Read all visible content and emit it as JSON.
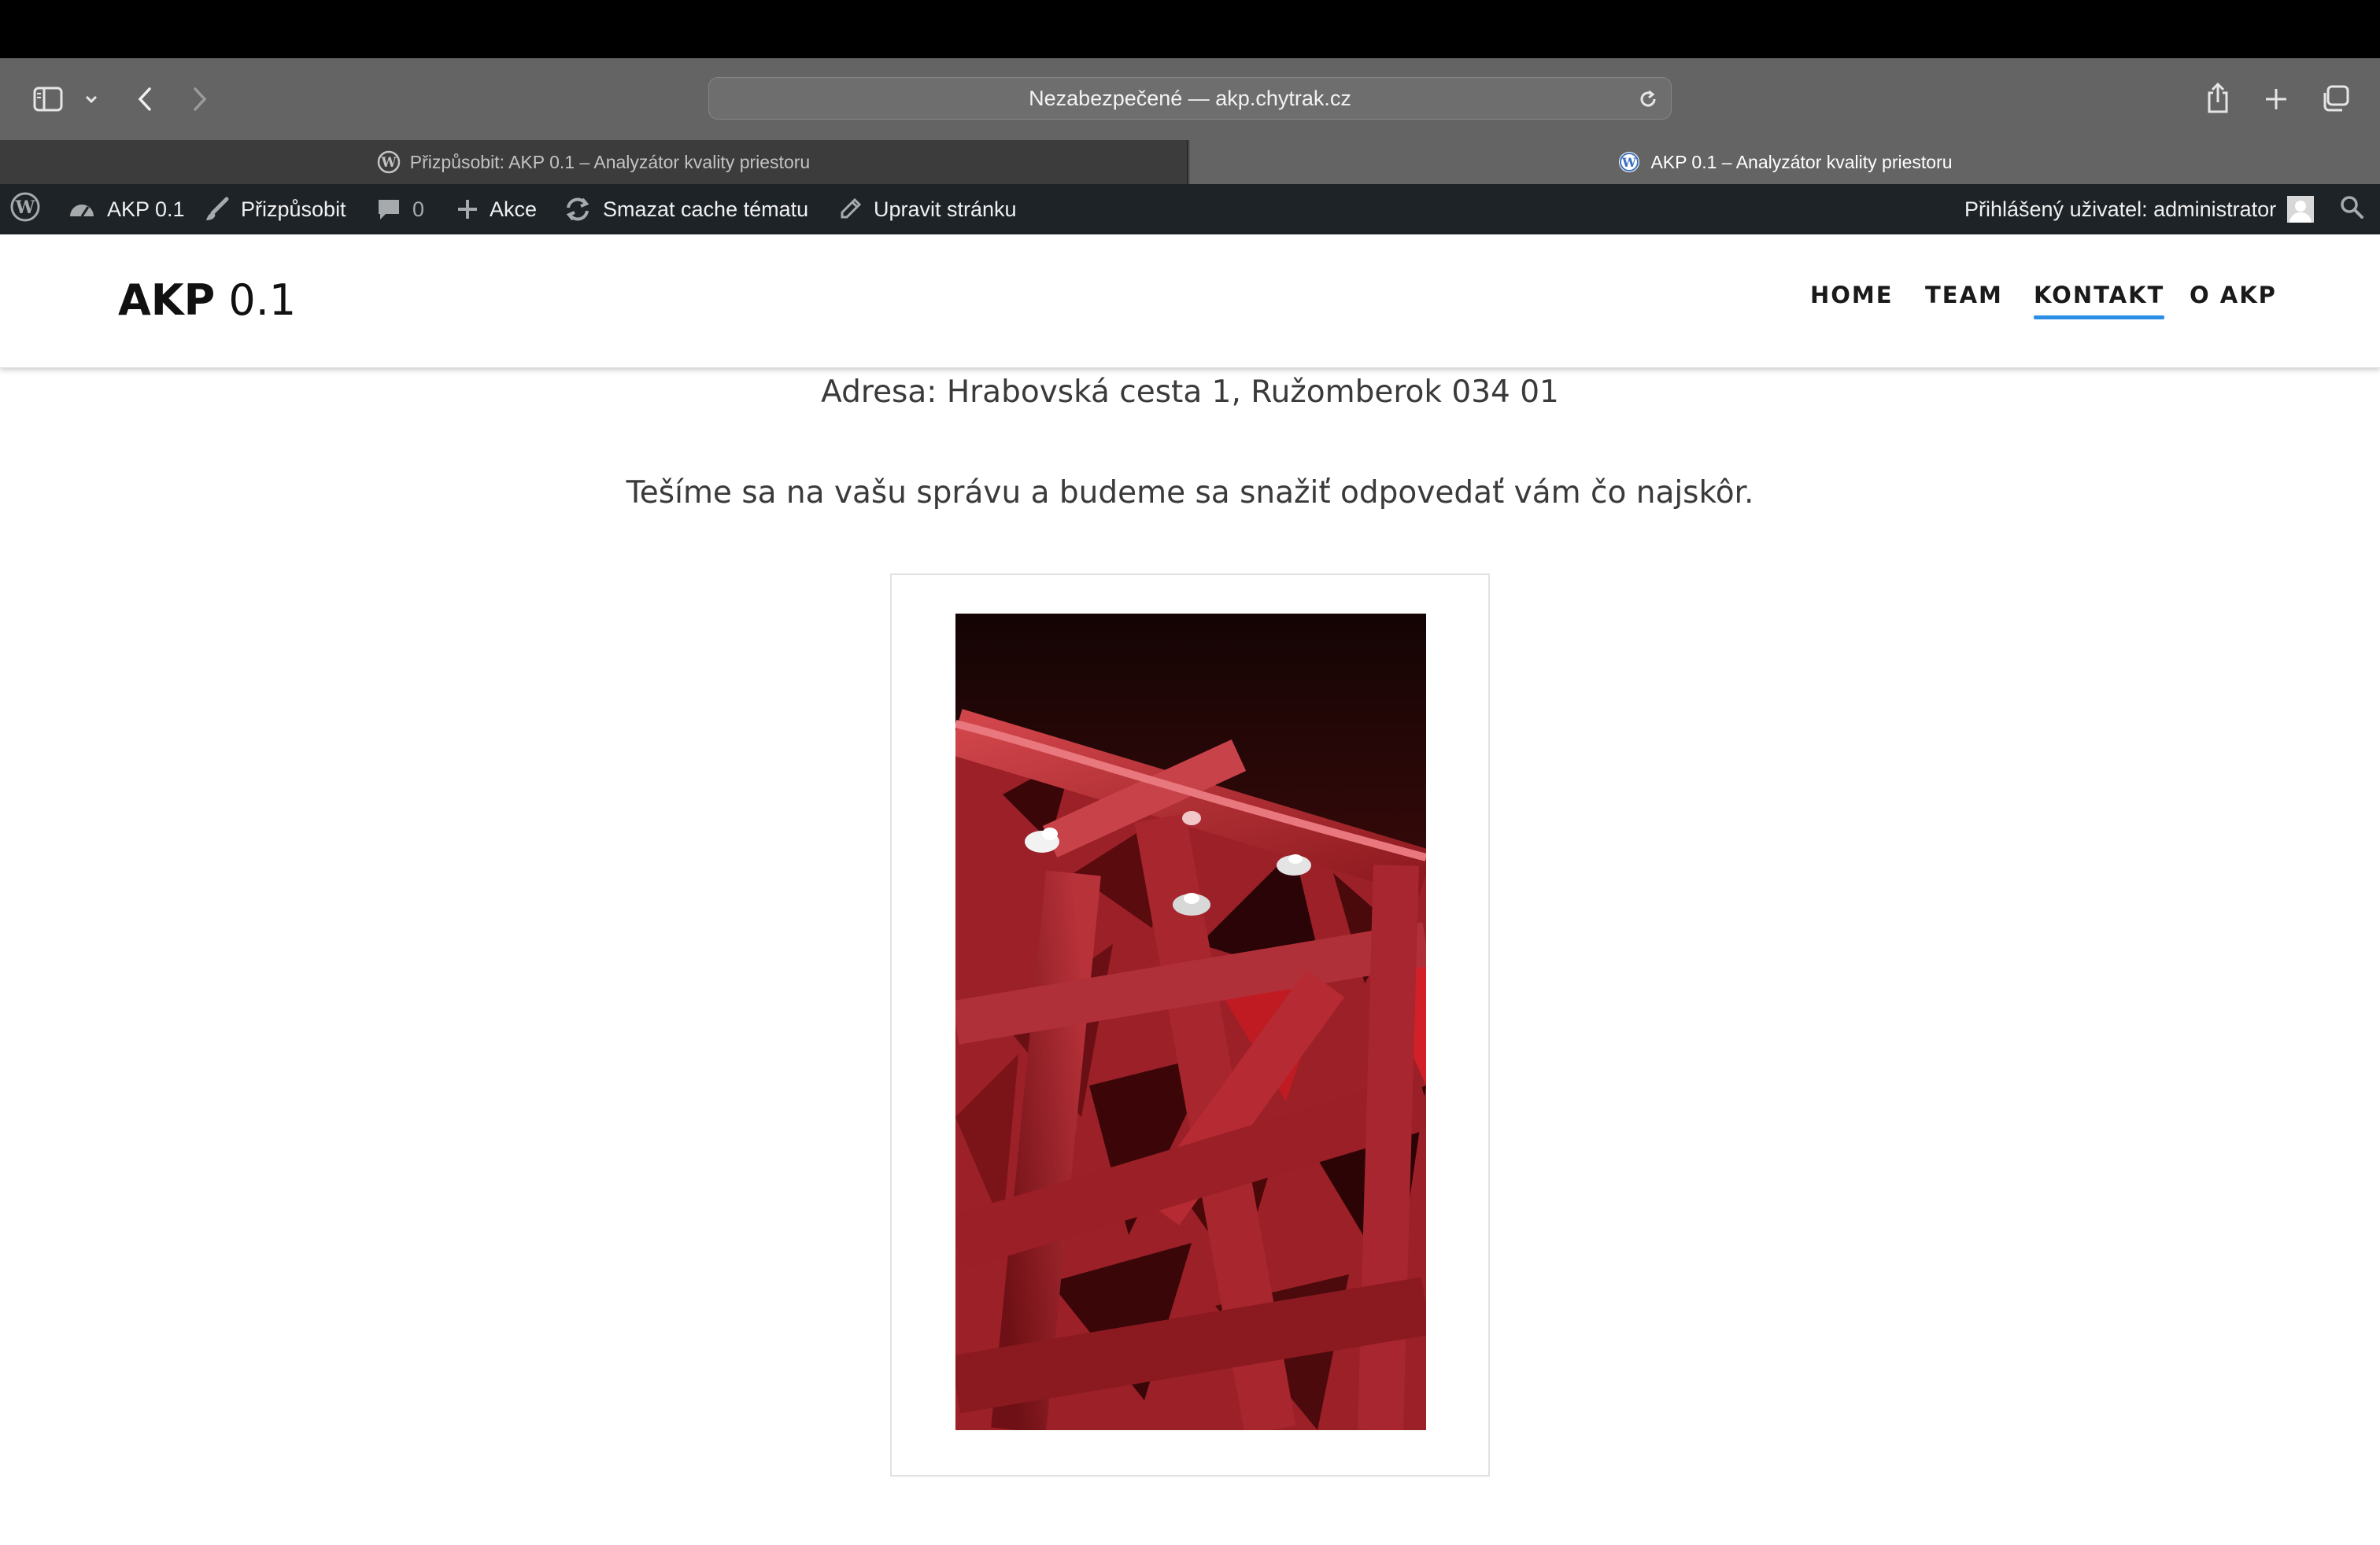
{
  "browser": {
    "address": "Nezabezpečené — akp.chytrak.cz",
    "tabs": [
      {
        "label": "Přizpůsobit: AKP 0.1 – Analyzátor kvality priestoru",
        "active": false
      },
      {
        "label": "AKP 0.1 – Analyzátor kvality priestoru",
        "active": true
      }
    ]
  },
  "adminbar": {
    "site": "AKP 0.1",
    "customize": "Přizpůsobit",
    "comments_count": "0",
    "new": "Akce",
    "clear_cache": "Smazat cache tématu",
    "edit_page": "Upravit stránku",
    "user": "Přihlášený uživatel: administrator"
  },
  "site": {
    "title_bold": "AKP",
    "title_light": "0.1",
    "nav": [
      {
        "label": "HOME",
        "current": false
      },
      {
        "label": "TEAM",
        "current": false
      },
      {
        "label": "KONTAKT",
        "current": true
      },
      {
        "label": "O AKP",
        "current": false
      }
    ],
    "accent_color": "#2a8ee6"
  },
  "content": {
    "address_line": "Adresa: Hrabovská cesta 1, Ružomberok 034 01",
    "message_line": "Tešíme sa na vašu správu a budeme sa snažiť odpovedať vám čo najskôr."
  },
  "icons": [
    "sidebar-icon",
    "chevron-down-icon",
    "back-icon",
    "forward-icon",
    "reload-icon",
    "share-icon",
    "new-tab-icon",
    "tab-overview-icon",
    "wordpress-icon",
    "dashboard-icon",
    "brush-icon",
    "comment-icon",
    "plus-icon",
    "refresh-icon",
    "pencil-icon",
    "search-icon"
  ]
}
